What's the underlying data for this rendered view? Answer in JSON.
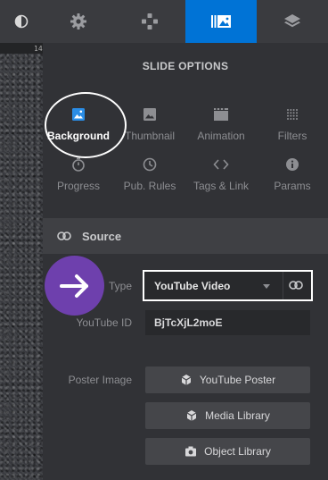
{
  "left": {
    "ruler_tick": "14"
  },
  "top_tabs": [
    {
      "icon": "gear-icon",
      "active": false
    },
    {
      "icon": "gamepad-icon",
      "active": false
    },
    {
      "icon": "slides-icon",
      "active": true
    },
    {
      "icon": "layers-icon",
      "active": false
    }
  ],
  "panel_title": "SLIDE OPTIONS",
  "options": [
    {
      "label": "Background",
      "icon": "image-icon",
      "active": true
    },
    {
      "label": "Thumbnail",
      "icon": "picture-icon",
      "active": false
    },
    {
      "label": "Animation",
      "icon": "film-icon",
      "active": false
    },
    {
      "label": "Filters",
      "icon": "dots-grid-icon",
      "active": false
    },
    {
      "label": "Progress",
      "icon": "timer-icon",
      "active": false
    },
    {
      "label": "Pub. Rules",
      "icon": "clock-icon",
      "active": false
    },
    {
      "label": "Tags & Link",
      "icon": "code-icon",
      "active": false
    },
    {
      "label": "Params",
      "icon": "info-icon",
      "active": false
    }
  ],
  "source": {
    "header": "Source",
    "type_label": "Type",
    "type_value": "YouTube Video",
    "youtube_id_label": "YouTube ID",
    "youtube_id_value": "BjTcXjL2moE",
    "poster_image_label": "Poster Image",
    "buttons": {
      "youtube_poster": "YouTube Poster",
      "media_library": "Media Library",
      "object_library": "Object Library"
    }
  },
  "colors": {
    "accent_blue": "#0073d6",
    "highlight_purple": "#6e40ad",
    "panel_bg": "#313236"
  }
}
